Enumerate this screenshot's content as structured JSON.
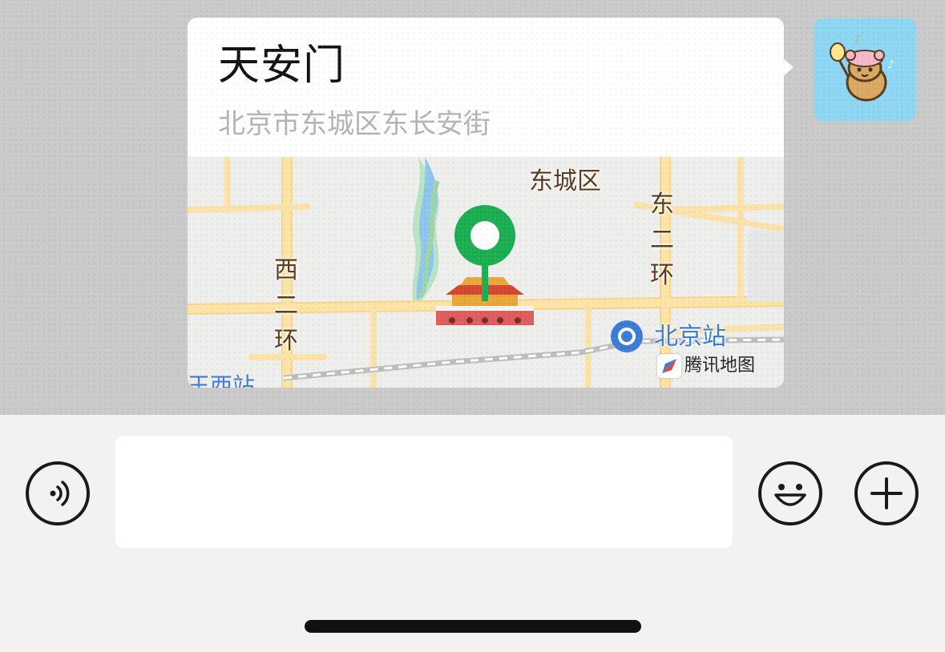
{
  "message": {
    "location_title": "天安门",
    "location_address": "北京市东城区东长安街"
  },
  "map": {
    "district_label": "东城区",
    "ring_road_east": "东二环",
    "ring_road_west": "西二环",
    "station_label": "北京站",
    "brand": "腾讯地图",
    "cut_off_label": "王西站",
    "pin_color": "#1aad51",
    "road_color": "#fde4a6"
  },
  "icons": {
    "voice": "voice-icon",
    "emoji": "emoji-icon",
    "plus": "plus-icon"
  },
  "input": {
    "value": ""
  }
}
